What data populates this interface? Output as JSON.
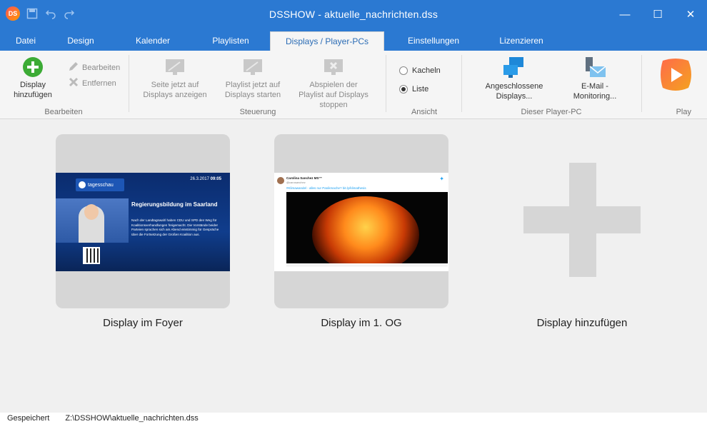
{
  "app": {
    "logo_text": "DS",
    "title": "DSSHOW - aktuelle_nachrichten.dss",
    "colors": {
      "titlebar": "#2b79d2",
      "accent": "#2b6cb5",
      "add_green": "#3cab35"
    }
  },
  "quick_access": {
    "icons": [
      "save-icon",
      "undo-icon",
      "redo-icon"
    ]
  },
  "window_controls": {
    "minimize": "—",
    "maximize": "☐",
    "close": "✕"
  },
  "tabs": [
    {
      "label": "Datei"
    },
    {
      "label": "Design"
    },
    {
      "label": "Kalender"
    },
    {
      "label": "Playlisten"
    },
    {
      "label": "Displays / Player-PCs",
      "active": true
    },
    {
      "label": "Einstellungen"
    },
    {
      "label": "Lizenzieren"
    }
  ],
  "ribbon": {
    "bearbeiten": {
      "add_display": "Display hinzufügen",
      "edit": "Bearbeiten",
      "remove": "Entfernen",
      "group_label": "Bearbeiten"
    },
    "steuerung": {
      "show_page": "Seite jetzt auf Displays anzeigen",
      "start_playlist": "Playlist jetzt auf Displays starten",
      "stop_playlist": "Abspielen der Playlist auf Displays stoppen",
      "group_label": "Steuerung"
    },
    "ansicht": {
      "kacheln": "Kacheln",
      "liste": "Liste",
      "selected": "Liste",
      "group_label": "Ansicht"
    },
    "player_pc": {
      "connected_displays": "Angeschlossene Displays...",
      "email_monitoring": "E-Mail - Monitoring...",
      "group_label": "Dieser Player-PC"
    },
    "play": {
      "group_label": "Play"
    }
  },
  "displays": [
    {
      "name": "Display im Foyer",
      "preview": {
        "brand": "tagesschau",
        "date": "26.3.2017",
        "time": "09:05",
        "headline": "Regierungsbildung im Saarland",
        "body": "Nach der Landtagswahl haben CDU und SPD den Weg für Koalitionsverhandlungen freigemacht. Die Vorstände beider Parteien sprachen sich am Abend einstimmig für Gespräche über die Fortsetzung der Großen Koalition aus."
      }
    },
    {
      "name": "Display im 1. OG",
      "preview": {
        "author": "Carolina Sanchez MS™",
        "handle": "@carosanchez",
        "tweet_text": "#Klimawandel - alles nur Panikmache?",
        "link": "bit.ly/klimathesis"
      }
    }
  ],
  "add_tile": {
    "label": "Display hinzufügen"
  },
  "statusbar": {
    "state": "Gespeichert",
    "path": "Z:\\DSSHOW\\aktuelle_nachrichten.dss"
  }
}
